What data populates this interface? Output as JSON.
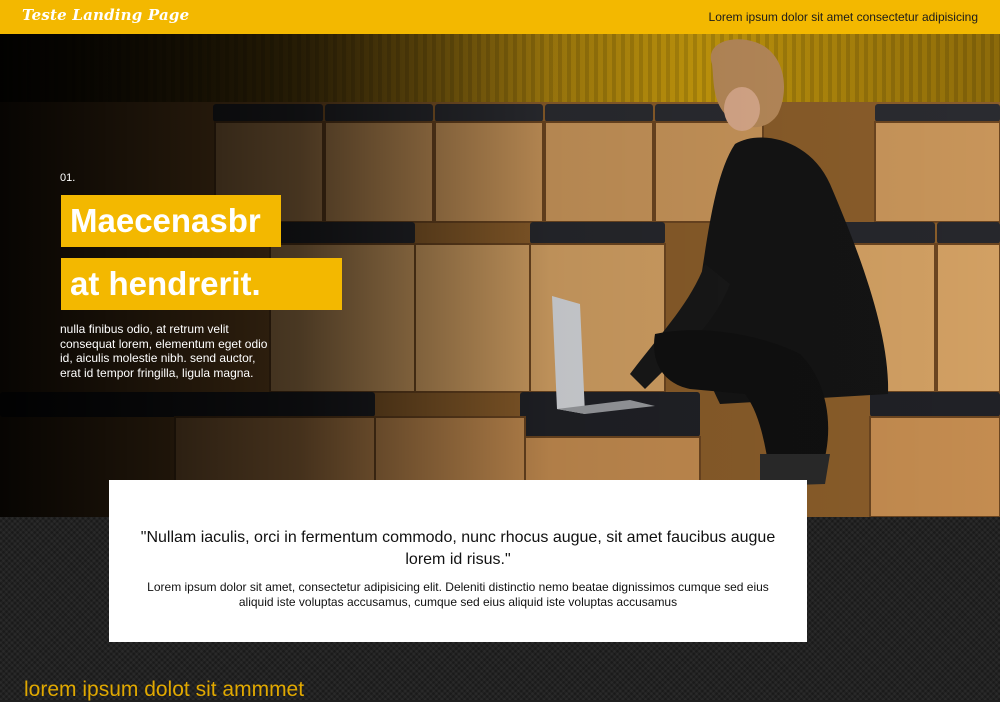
{
  "header": {
    "brand": "Teste Landing Page",
    "tagline": "Lorem ipsum dolor sit amet consectetur adipisicing"
  },
  "hero": {
    "number": "01.",
    "headline_line1": "Maecenasbr",
    "headline_line2": "at hendrerit.",
    "description": "nulla finibus odio, at retrum velit consequat lorem, elementum eget odio id, aiculis molestie nibh. send auctor, erat id tempor fringilla, ligula magna."
  },
  "testimonial": {
    "quote": "\"Nullam iaculis, orci in fermentum commodo, nunc rhocus augue, sit amet faucibus augue lorem id risus.\"",
    "text": "Lorem ipsum dolor sit amet, consectetur adipisicing elit. Deleniti distinctio nemo beatae dignissimos cumque sed eius aliquid iste voluptas accusamus, cumque sed eius aliquid iste voluptas accusamus"
  },
  "section": {
    "heading": "lorem ipsum dolot sit ammmet"
  },
  "colors": {
    "accent": "#f3b800",
    "dark": "#222222",
    "heading_text": "#e0a800"
  }
}
